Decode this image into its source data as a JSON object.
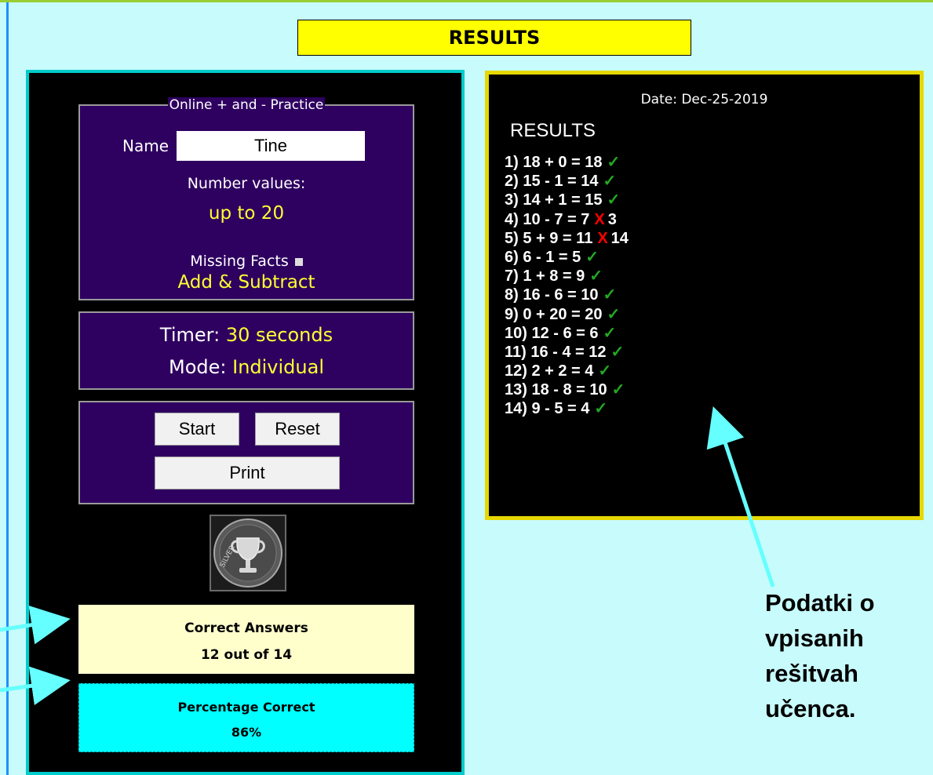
{
  "header": {
    "title": "RESULTS"
  },
  "settings": {
    "legend": "Online + and - Practice",
    "name_label": "Name",
    "name_value": "Tine",
    "number_values_label": "Number values:",
    "number_values": "up to 20",
    "missing_facts_label": "Missing Facts",
    "operation": "Add & Subtract"
  },
  "timer": {
    "timer_label": "Timer:",
    "timer_value": "30 seconds",
    "mode_label": "Mode:",
    "mode_value": "Individual"
  },
  "buttons": {
    "start": "Start",
    "reset": "Reset",
    "print": "Print"
  },
  "trophy": {
    "icon": "silver-trophy-icon",
    "text": "SILVER"
  },
  "score": {
    "correct_title": "Correct Answers",
    "correct_value": "12 out of 14",
    "percent_title": "Percentage Correct",
    "percent_value": "86%"
  },
  "results": {
    "date": "Date: Dec-25-2019",
    "heading": "RESULTS",
    "items": [
      {
        "text": "1) 18 + 0 = 18",
        "correct": true,
        "answer": ""
      },
      {
        "text": "2) 15 - 1 = 14",
        "correct": true,
        "answer": ""
      },
      {
        "text": "3) 14 + 1 = 15",
        "correct": true,
        "answer": ""
      },
      {
        "text": "4) 10 - 7 = 7",
        "correct": false,
        "answer": "3"
      },
      {
        "text": "5) 5 + 9 = 11",
        "correct": false,
        "answer": "14"
      },
      {
        "text": "6) 6 - 1 = 5",
        "correct": true,
        "answer": ""
      },
      {
        "text": "7) 1 + 8 = 9",
        "correct": true,
        "answer": ""
      },
      {
        "text": "8) 16 - 6 = 10",
        "correct": true,
        "answer": ""
      },
      {
        "text": "9) 0 + 20 = 20",
        "correct": true,
        "answer": ""
      },
      {
        "text": "10) 12 - 6 = 6",
        "correct": true,
        "answer": ""
      },
      {
        "text": "11) 16 - 4 = 12",
        "correct": true,
        "answer": ""
      },
      {
        "text": "12) 2 + 2 = 4",
        "correct": true,
        "answer": ""
      },
      {
        "text": "13) 18 - 8 = 10",
        "correct": true,
        "answer": ""
      },
      {
        "text": "14) 9 - 5 = 4",
        "correct": true,
        "answer": ""
      }
    ],
    "check_mark": "✓",
    "cross_mark": "X"
  },
  "annotation": {
    "caption_lines": [
      "Podatki o",
      "vpisanih",
      "rešitvah",
      "učenca."
    ],
    "arrow_color": "#66ffff"
  }
}
